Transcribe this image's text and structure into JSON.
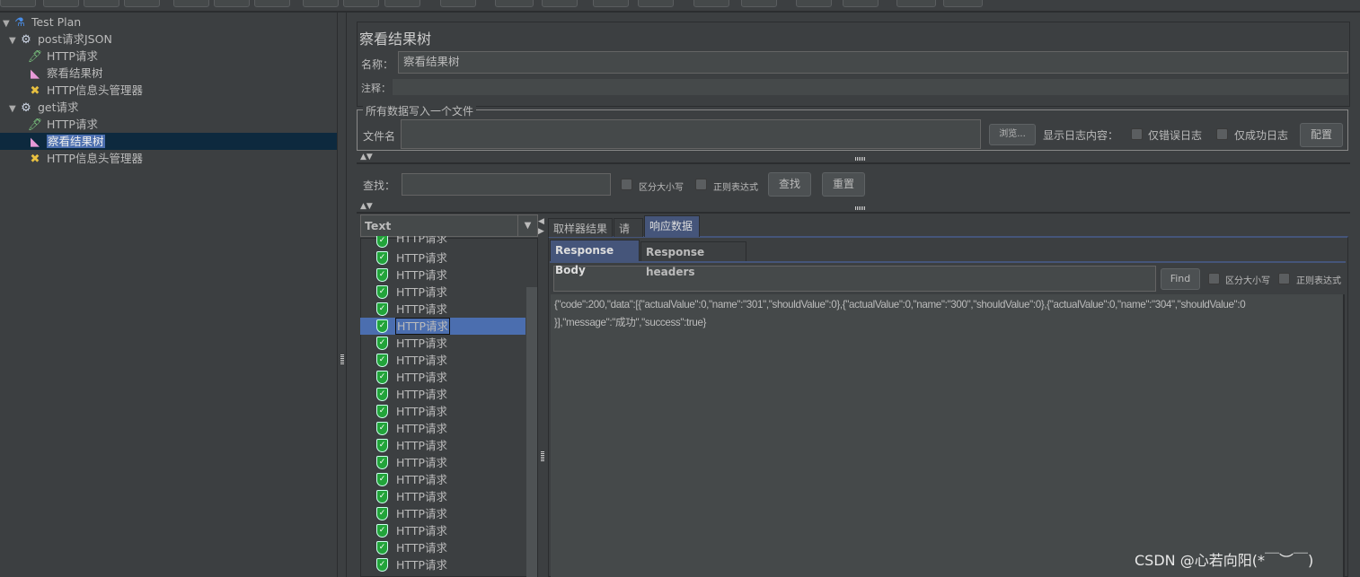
{
  "tree": {
    "items": [
      {
        "label": "Test Plan",
        "icon": "flask-icon",
        "level": 0,
        "expanded": true
      },
      {
        "label": "post请求JSON",
        "icon": "gear-icon",
        "level": 1,
        "expanded": true
      },
      {
        "label": "HTTP请求",
        "icon": "pipette-icon",
        "level": 2
      },
      {
        "label": "察看结果树",
        "icon": "chart-icon",
        "level": 2
      },
      {
        "label": "HTTP信息头管理器",
        "icon": "tools-icon",
        "level": 2
      },
      {
        "label": "get请求",
        "icon": "gear-icon",
        "level": 1,
        "expanded": true
      },
      {
        "label": "HTTP请求",
        "icon": "pipette-icon",
        "level": 2
      },
      {
        "label": "察看结果树",
        "icon": "chart-icon",
        "level": 2,
        "selected": true
      },
      {
        "label": "HTTP信息头管理器",
        "icon": "tools-icon",
        "level": 2
      }
    ]
  },
  "panel": {
    "title": "察看结果树",
    "name_label": "名称：",
    "name_value": "察看结果树",
    "comment_label": "注释：",
    "comment_value": "",
    "file_group_title": "所有数据写入一个文件",
    "filename_label": "文件名",
    "filename_value": "",
    "browse_label": "浏览...",
    "log_label": "显示日志内容：",
    "errors_only_label": "仅错误日志",
    "success_only_label": "仅成功日志",
    "configure_label": "配置"
  },
  "search": {
    "label": "查找：",
    "value": "",
    "case_label": "区分大小写",
    "regex_label": "正则表达式",
    "find_label": "查找",
    "reset_label": "重置"
  },
  "results": {
    "renderer": "Text",
    "items": [
      "HTTP请求",
      "HTTP请求",
      "HTTP请求",
      "HTTP请求",
      "HTTP请求",
      "HTTP请求",
      "HTTP请求",
      "HTTP请求",
      "HTTP请求",
      "HTTP请求",
      "HTTP请求",
      "HTTP请求",
      "HTTP请求",
      "HTTP请求",
      "HTTP请求",
      "HTTP请求",
      "HTTP请求",
      "HTTP请求",
      "HTTP请求",
      "HTTP请求"
    ],
    "selected_index": 5,
    "status_color": "#22a43a"
  },
  "detail": {
    "tabs": [
      "取样器结果",
      "请求",
      "响应数据"
    ],
    "active_tab": 2,
    "subtabs": [
      "Response Body",
      "Response headers"
    ],
    "active_subtab": 0,
    "find_value": "",
    "find_label": "Find",
    "case_label": "区分大小写",
    "regex_label": "正则表达式",
    "body_line1": "{\"code\":200,\"data\":[{\"actualValue\":0,\"name\":\"301\",\"shouldValue\":0},{\"actualValue\":0,\"name\":\"300\",\"shouldValue\":0},{\"actualValue\":0,\"name\":\"304\",\"shouldValue\":0",
    "body_line2": "}],\"message\":\"成功\",\"success\":true}"
  },
  "watermark": "CSDN @心若向阳(*￣︶￣)"
}
